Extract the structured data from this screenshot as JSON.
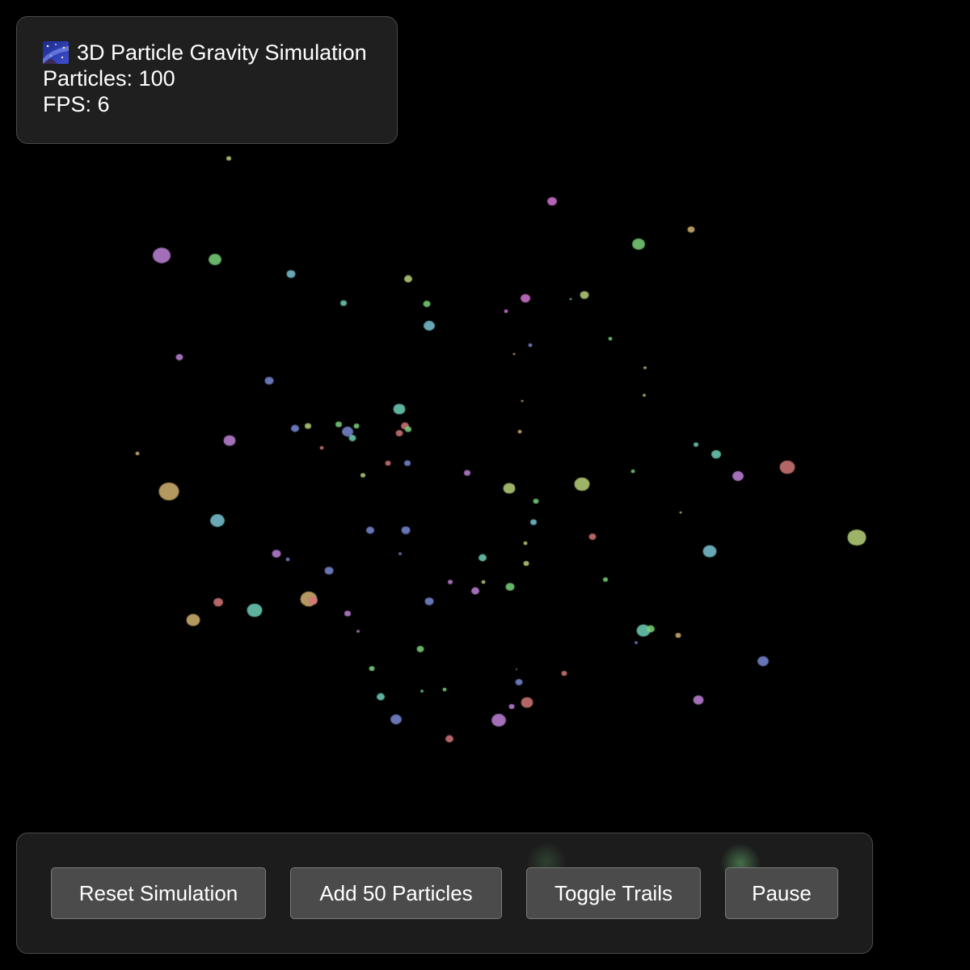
{
  "info": {
    "icon": "milky-way-icon",
    "title": "3D Particle Gravity Simulation",
    "particles_label": "Particles: ",
    "particles_count": "100",
    "fps_label": "FPS: ",
    "fps_value": "6"
  },
  "controls": {
    "reset_label": "Reset Simulation",
    "add_label": "Add 50 Particles",
    "trails_label": "Toggle Trails",
    "pause_label": "Pause"
  },
  "colors": {
    "background": "#000000",
    "panel": "#222222",
    "button": "#4b4b4b",
    "particle_palette": [
      "#7ad37a",
      "#d474d4",
      "#6fd0b8",
      "#7a8ad4",
      "#d2b370",
      "#d47878",
      "#b8d47a",
      "#7ac4d4",
      "#c083d8"
    ]
  }
}
